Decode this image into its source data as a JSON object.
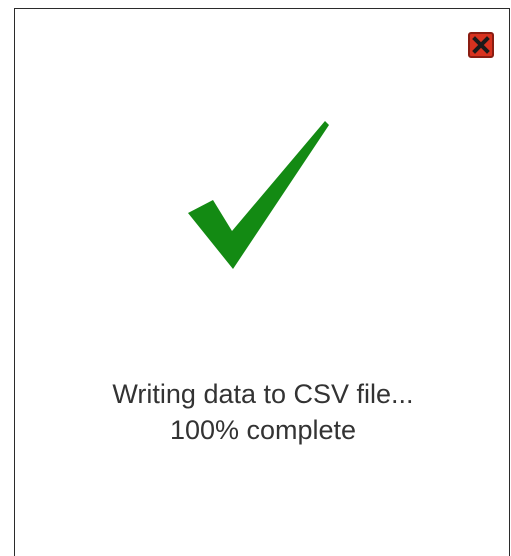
{
  "dialog": {
    "close_icon": "close-icon",
    "status_icon": "checkmark-icon",
    "status_line": "Writing data to CSV file...",
    "progress_text": "100% complete",
    "progress": 100
  },
  "colors": {
    "check": "#138a13",
    "close_button": "#d7321f",
    "text": "#333333",
    "border": "#2b2b2b"
  }
}
